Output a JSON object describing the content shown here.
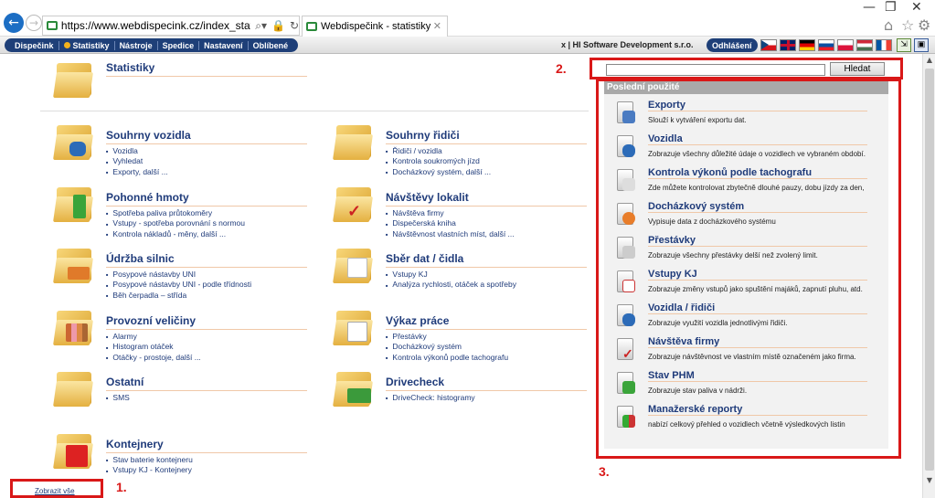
{
  "browser": {
    "url": "https://www.webdispecink.cz/index_stat.php",
    "tab_title": "Webdispečink - statistiky",
    "tab_close": "✕",
    "back_icon": "arrow-left-icon",
    "forward_icon": "arrow-right-icon",
    "window_controls": [
      "—",
      "❐",
      "✕"
    ]
  },
  "menubar": {
    "items": [
      "Dispečink",
      "Statistiky",
      "Nástroje",
      "Spedice",
      "Nastavení",
      "Oblíbené"
    ],
    "company": "x  |  HI Software Development s.r.o.",
    "logout": "Odhlášení",
    "flags": [
      "cz",
      "gb",
      "de",
      "sk",
      "pl",
      "hu",
      "fr"
    ]
  },
  "main": {
    "statistics_title": "Statistiky",
    "categories": [
      {
        "title": "Souhrny vozidla",
        "links": [
          "Vozidla",
          "Vyhledat",
          "Exporty, další ..."
        ]
      },
      {
        "title": "Souhrny řidiči",
        "links": [
          "Řidiči / vozidla",
          "Kontrola soukromých jízd",
          "Docházkový systém, další ..."
        ]
      },
      {
        "title": "Pohonné hmoty",
        "links": [
          "Spotřeba paliva průtokoměry",
          "Vstupy - spotřeba porovnání s normou",
          "Kontrola nákladů - měny, další ..."
        ]
      },
      {
        "title": "Návštěvy lokalit",
        "links": [
          "Návštěva firmy",
          "Dispečerská kniha",
          "Návštěvnost vlastních míst, další ..."
        ]
      },
      {
        "title": "Údržba silnic",
        "links": [
          "Posypové nástavby UNI",
          "Posypové nástavby UNI - podle třídnosti",
          "Běh čerpadla – střída"
        ]
      },
      {
        "title": "Sběr dat / čidla",
        "links": [
          "Vstupy KJ",
          "Analýza rychlosti, otáček a spotřeby"
        ]
      },
      {
        "title": "Provozní veličiny",
        "links": [
          "Alarmy",
          "Histogram otáček",
          "Otáčky - prostoje, další ..."
        ]
      },
      {
        "title": "Výkaz práce",
        "links": [
          "Přestávky",
          "Docházkový systém",
          "Kontrola výkonů podle tachografu"
        ]
      },
      {
        "title": "Ostatní",
        "links": [
          "SMS"
        ]
      },
      {
        "title": "Drivecheck",
        "links": [
          "DriveCheck: histogramy"
        ]
      },
      {
        "title": "Kontejnery",
        "links": [
          "Stav baterie kontejneru",
          "Vstupy KJ - Kontejnery"
        ]
      }
    ],
    "show_all": "Zobrazit vše"
  },
  "search": {
    "value": "",
    "button": "Hledat"
  },
  "recent": {
    "header": "Poslední použité",
    "items": [
      {
        "title": "Exporty",
        "desc": "Slouží k vytváření exportu dat."
      },
      {
        "title": "Vozidla",
        "desc": "Zobrazuje všechny důležité údaje o vozidlech ve vybraném období."
      },
      {
        "title": "Kontrola výkonů podle tachografu",
        "desc": "Zde můžete kontrolovat zbytečně dlouhé pauzy, dobu jízdy za den,"
      },
      {
        "title": "Docházkový systém",
        "desc": "Vypisuje data z docházkového systému"
      },
      {
        "title": "Přestávky",
        "desc": "Zobrazuje všechny přestávky delší než zvolený limit."
      },
      {
        "title": "Vstupy KJ",
        "desc": "Zobrazuje změny vstupů jako spuštění majáků, zapnutí pluhu, atd."
      },
      {
        "title": "Vozidla / řidiči",
        "desc": "Zobrazuje využití vozidla jednotlivými řidiči."
      },
      {
        "title": "Návštěva firmy",
        "desc": "Zobrazuje návštěvnost ve vlastním místě označeném jako firma."
      },
      {
        "title": "Stav PHM",
        "desc": "Zobrazuje stav paliva v nádrži."
      },
      {
        "title": "Manažerské reporty",
        "desc": "nabízí celkový přehled o vozidlech včetně výsledkových listin"
      }
    ]
  },
  "annotations": [
    "1.",
    "2.",
    "3."
  ],
  "colors": {
    "accent": "#1e3f78",
    "link": "#1f3b7a",
    "annotation": "#d91818"
  }
}
